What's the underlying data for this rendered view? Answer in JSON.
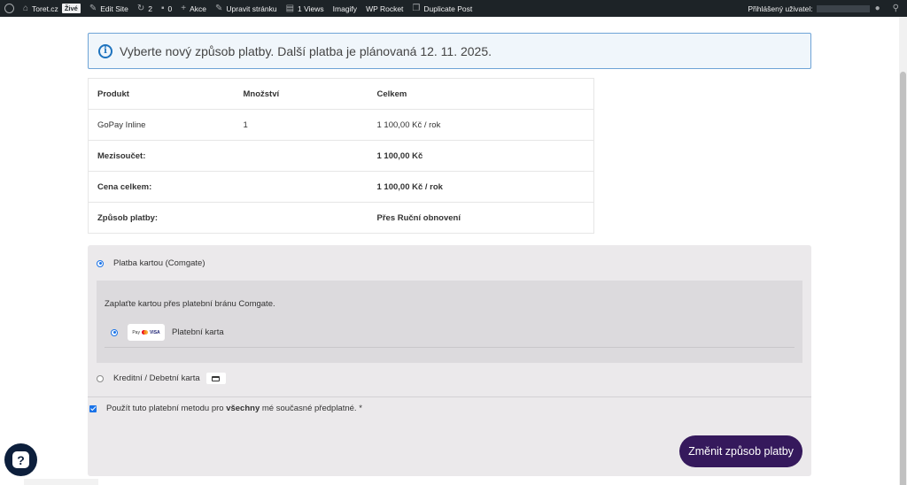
{
  "adminbar": {
    "site_name": "Toret.cz",
    "live_badge": "Živé",
    "edit_site": "Edit Site",
    "updates_count": "2",
    "comments_count": "0",
    "new_label": "Akce",
    "edit_page": "Upravit stránku",
    "views": "1 Views",
    "imagify": "Imagify",
    "wp_rocket": "WP Rocket",
    "duplicate_post": "Duplicate Post",
    "logged_in_label": "Přihlášený uživatel:"
  },
  "notice": {
    "text": "Vyberte nový způsob platby. Další platba je plánovaná 12. 11. 2025."
  },
  "order_table": {
    "headers": [
      "Produkt",
      "Množství",
      "Celkem"
    ],
    "item": {
      "product": "GoPay Inline",
      "qty": "1",
      "total": "1 100,00 Kč / rok"
    },
    "subtotal_label": "Mezisoučet:",
    "subtotal_value": "1 100,00 Kč",
    "total_label": "Cena celkem:",
    "total_value": "1 100,00 Kč / rok",
    "method_label": "Způsob platby:",
    "method_value": "Přes Ruční obnovení"
  },
  "payment": {
    "option1_label": "Platba kartou (Comgate)",
    "option1_desc": "Zaplaťte kartou přes platební bránu Comgate.",
    "sub_option_label": "Platební karta",
    "card_logos": {
      "applepay": "Pay",
      "visa": "VISA"
    },
    "option2_label": "Kreditní / Debetní karta",
    "checkbox_prefix": "Použít tuto platební metodu pro",
    "checkbox_bold": "všechny",
    "checkbox_suffix": "mé současné předplatné. *",
    "submit_label": "Změnit způsob platby"
  },
  "help": {
    "icon_glyph": "?"
  },
  "colors": {
    "accent": "#35195c",
    "notice_border": "#6ea3d6",
    "radio": "#1a73e8"
  }
}
